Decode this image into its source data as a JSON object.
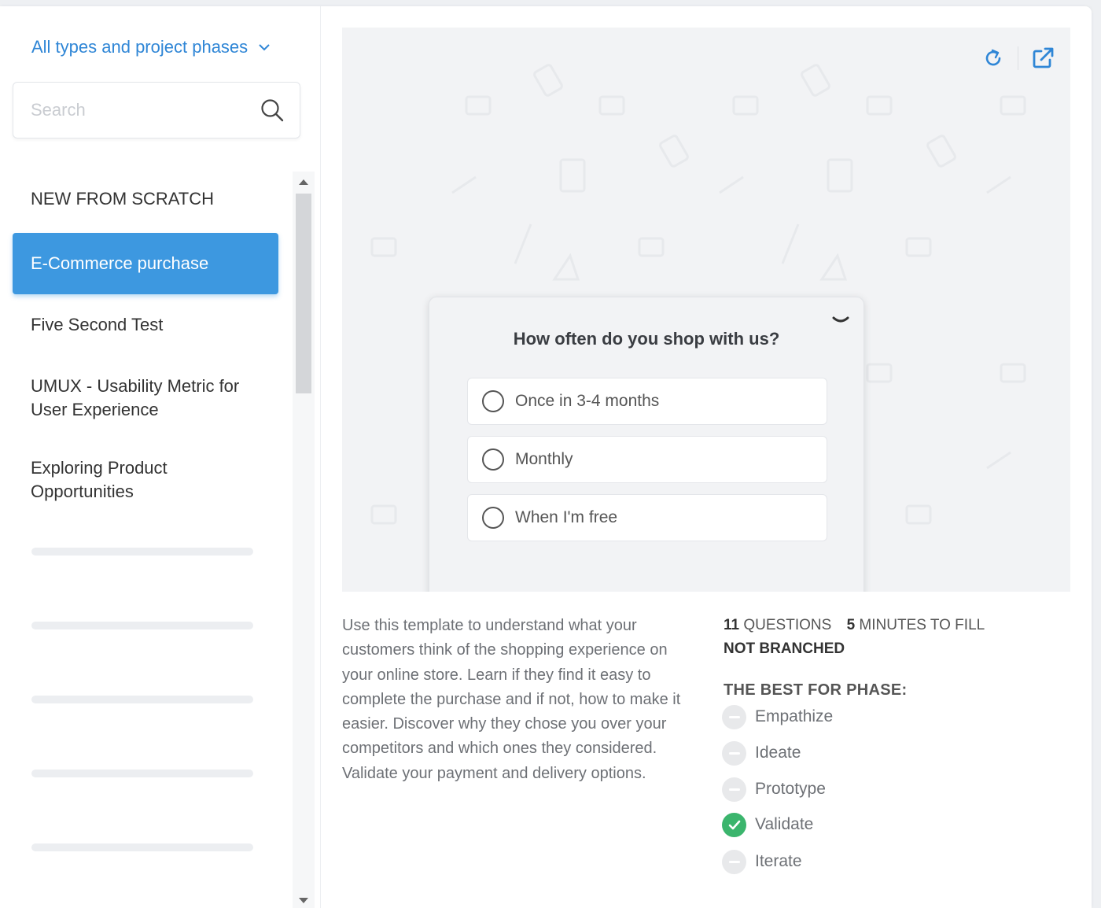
{
  "sidebar": {
    "filter_label": "All types and project phases",
    "search_placeholder": "Search",
    "items": [
      {
        "label": "NEW FROM SCRATCH"
      },
      {
        "label": "E-Commerce purchase"
      },
      {
        "label": "Five Second Test"
      },
      {
        "label": "UMUX - Usability Metric for User Experience"
      },
      {
        "label": "Exploring Product Opportunities"
      }
    ]
  },
  "preview": {
    "question": "How often do you shop with us?",
    "options": [
      "Once in 3-4 months",
      "Monthly",
      "When I'm free"
    ]
  },
  "details": {
    "description": "Use this template to understand what your customers think of the shopping experience on your online store. Learn if they find it easy to complete the purchase and if not, how to make it easier. Discover why they chose you over your competitors and which ones they considered. Validate your payment and delivery options.",
    "questions_count": "11",
    "questions_label": "QUESTIONS",
    "minutes_count": "5",
    "minutes_label": "MINUTES TO FILL",
    "branching": "NOT BRANCHED",
    "phase_title": "THE BEST FOR PHASE:",
    "phases": [
      {
        "label": "Empathize",
        "active": false
      },
      {
        "label": "Ideate",
        "active": false
      },
      {
        "label": "Prototype",
        "active": false
      },
      {
        "label": "Validate",
        "active": true
      },
      {
        "label": "Iterate",
        "active": false
      }
    ]
  },
  "colors": {
    "accent": "#3d98e0",
    "link": "#2f86d6",
    "success": "#3bb56d"
  },
  "icons": {
    "filter": "chevron-down-icon",
    "search": "search-icon",
    "refresh": "refresh-icon",
    "open": "external-link-icon",
    "collapse": "chevron-down-icon",
    "phase_on": "check-circle-icon",
    "phase_off": "minus-circle-icon"
  }
}
